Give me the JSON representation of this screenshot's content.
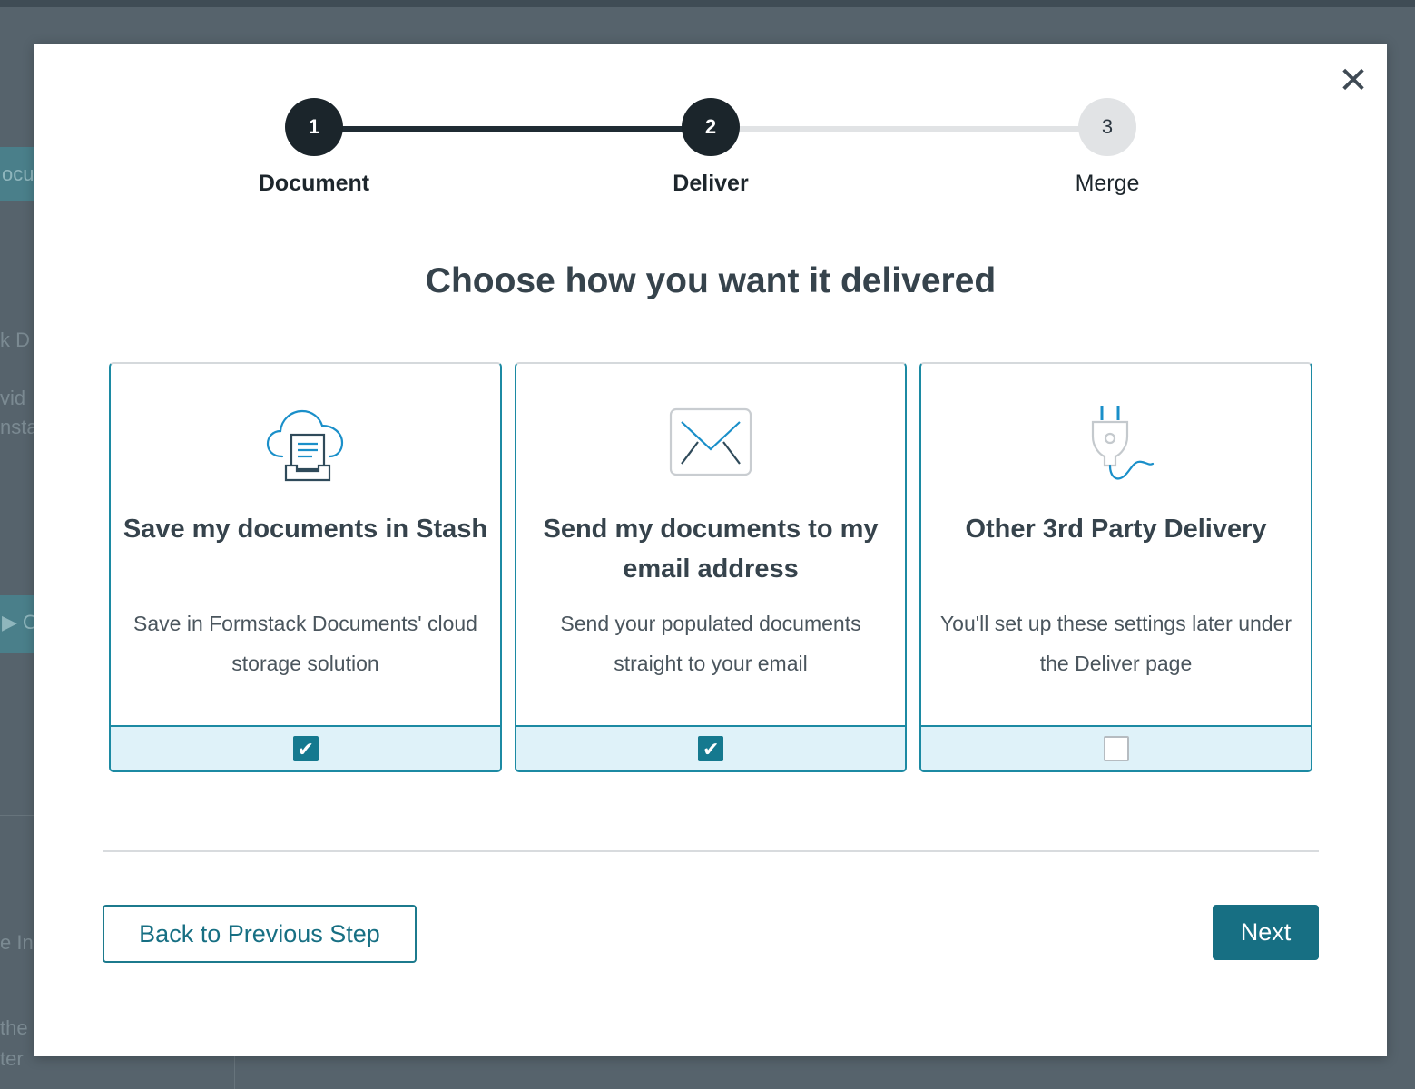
{
  "background": {
    "fragments": [
      "ocu",
      "k D",
      "vid",
      "nsta",
      "▶ O",
      "e In",
      "the",
      "ter"
    ]
  },
  "modal": {
    "close_icon": "close-icon",
    "stepper": {
      "steps": [
        {
          "number": "1",
          "label": "Document",
          "state": "complete"
        },
        {
          "number": "2",
          "label": "Deliver",
          "state": "current"
        },
        {
          "number": "3",
          "label": "Merge",
          "state": "upcoming"
        }
      ]
    },
    "title": "Choose how you want it delivered",
    "options": [
      {
        "icon": "cloud-storage-icon",
        "title": "Save my documents in Stash",
        "description": "Save in Formstack Documents' cloud storage solution",
        "checked": true
      },
      {
        "icon": "envelope-icon",
        "title": "Send my documents to my email address",
        "description": "Send your populated documents straight to your email",
        "checked": true
      },
      {
        "icon": "plug-icon",
        "title": "Other 3rd Party Delivery",
        "description": "You'll set up these settings later under the Deliver page",
        "checked": false
      }
    ],
    "buttons": {
      "back_label": "Back to Previous Step",
      "next_label": "Next"
    },
    "colors": {
      "primary": "#176f83",
      "step_active": "#1b252b",
      "selected_footer": "#dff2f9",
      "icon_blue": "#1a8fc9"
    }
  }
}
